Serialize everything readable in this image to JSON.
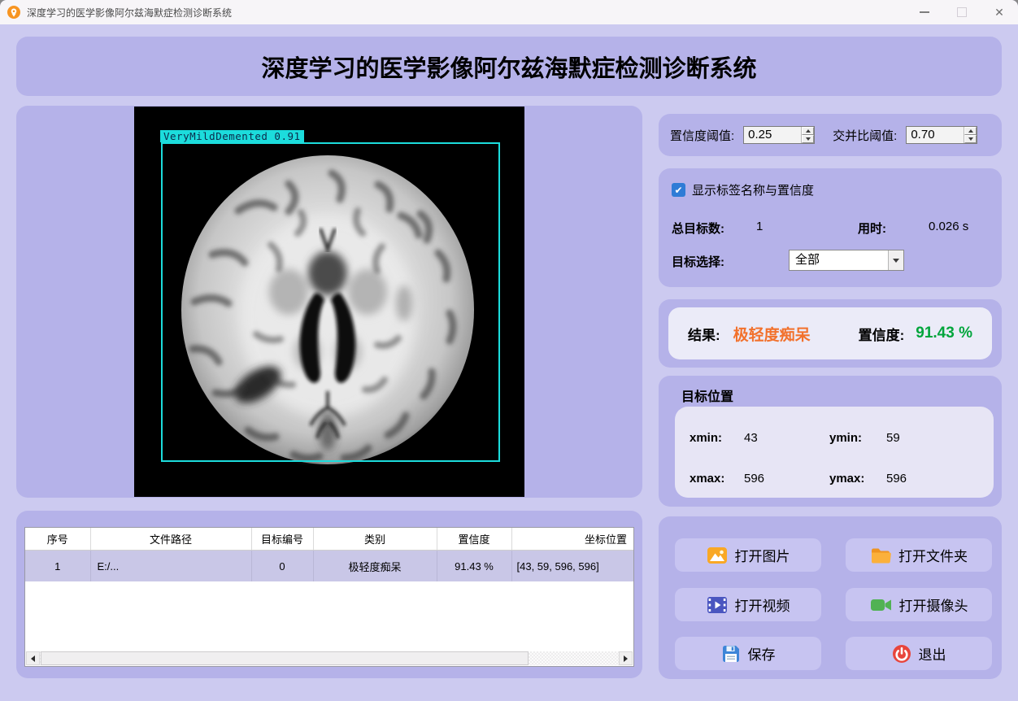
{
  "window": {
    "title": "深度学习的医学影像阿尔兹海默症检测诊断系统",
    "close_glyph": "✕"
  },
  "banner": {
    "title": "深度学习的医学影像阿尔兹海默症检测诊断系统"
  },
  "viewer": {
    "detection_label": "VeryMildDemented 0.91"
  },
  "thresholds": {
    "confidence_label": "置信度阈值:",
    "confidence_value": "0.25",
    "iou_label": "交并比阈值:",
    "iou_value": "0.70"
  },
  "detection": {
    "show_labels_checkbox": "显示标签名称与置信度",
    "checkbox_glyph": "✔",
    "total_label": "总目标数:",
    "total_value": "1",
    "time_label": "用时:",
    "time_value": "0.026 s",
    "select_label": "目标选择:",
    "select_value": "全部"
  },
  "result": {
    "label": "结果:",
    "value": "极轻度痴呆",
    "value_color": "#f2712c",
    "confidence_label": "置信度:",
    "confidence_value": "91.43 %",
    "confidence_color": "#00a53c"
  },
  "position": {
    "title": "目标位置",
    "xmin_label": "xmin:",
    "xmin_value": "43",
    "ymin_label": "ymin:",
    "ymin_value": "59",
    "xmax_label": "xmax:",
    "xmax_value": "596",
    "ymax_label": "ymax:",
    "ymax_value": "596"
  },
  "table": {
    "headers": [
      "序号",
      "文件路径",
      "目标编号",
      "类别",
      "置信度",
      "坐标位置"
    ],
    "rows": [
      [
        "1",
        "E:/...",
        "0",
        "极轻度痴呆",
        "91.43 %",
        "[43, 59, 596, 596]"
      ]
    ]
  },
  "buttons": {
    "open_image": "打开图片",
    "open_folder": "打开文件夹",
    "open_video": "打开视频",
    "open_camera": "打开摄像头",
    "save": "保存",
    "exit": "退出"
  }
}
